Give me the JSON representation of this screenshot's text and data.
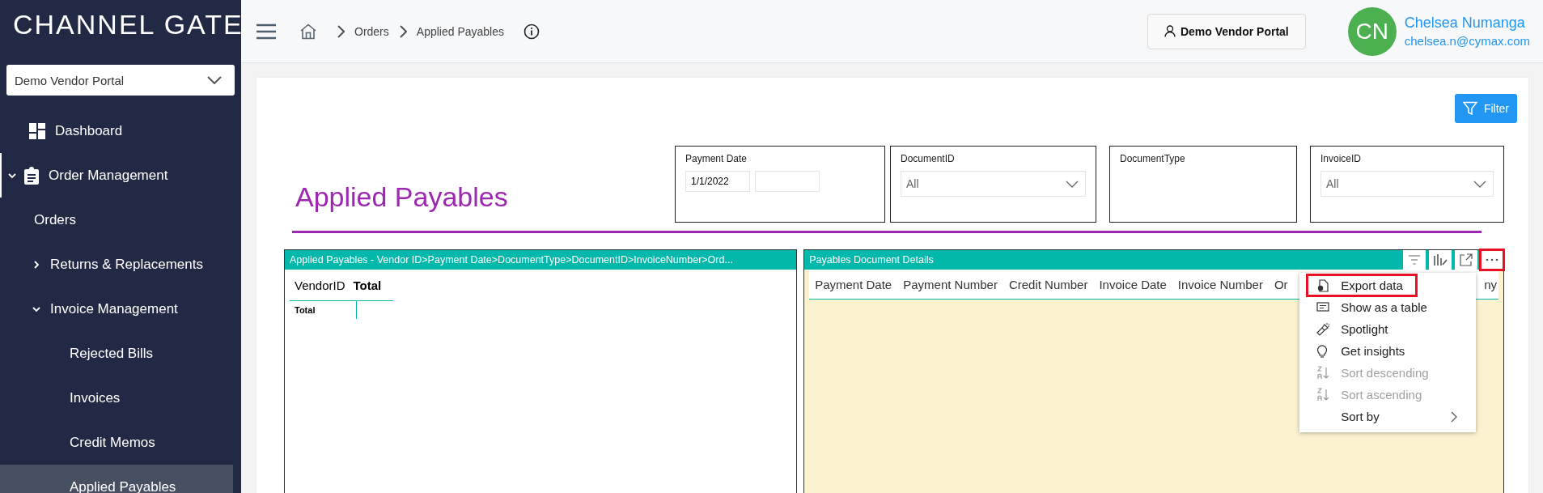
{
  "sidebar": {
    "logo": "CHANNEL GATE",
    "portal_select": {
      "value": "Demo Vendor Portal"
    },
    "items": [
      {
        "label": "Dashboard",
        "kind": "dashboard",
        "highlighted": false,
        "selected": false
      },
      {
        "label": "Order Management",
        "kind": "section",
        "highlighted": true,
        "selected": false,
        "expanded": true,
        "children": [
          {
            "label": "Orders",
            "selected": false
          },
          {
            "label": "Returns & Replacements",
            "selected": false,
            "expanded": false
          },
          {
            "label": "Invoice Management",
            "selected": false,
            "expanded": true,
            "children": [
              {
                "label": "Rejected Bills",
                "selected": false
              },
              {
                "label": "Invoices",
                "selected": false
              },
              {
                "label": "Credit Memos",
                "selected": false
              },
              {
                "label": "Applied Payables",
                "selected": true
              }
            ]
          }
        ]
      }
    ]
  },
  "header": {
    "breadcrumb": [
      {
        "label": "Orders"
      },
      {
        "label": "Applied Payables"
      }
    ],
    "portal_button": "Demo Vendor Portal",
    "user": {
      "initials": "CN",
      "name": "Chelsea Numanga",
      "email": "chelsea.n@cymax.com"
    }
  },
  "report": {
    "filter_button": "Filter",
    "title": "Applied Payables",
    "slicers": [
      {
        "kind": "date_range",
        "label": "Payment Date",
        "start": "1/1/2022"
      },
      {
        "kind": "dropdown",
        "label": "DocumentID",
        "value": "All"
      },
      {
        "kind": "blank",
        "label": "DocumentType"
      },
      {
        "kind": "dropdown",
        "label": "InvoiceID",
        "value": "All"
      }
    ],
    "visuals": [
      {
        "kind": "matrix",
        "title": "Applied Payables - Vendor ID>Payment Date>DocumentType>DocumentID>InvoiceNumber>Ord...",
        "columns": [
          "VendorID",
          "Total"
        ],
        "rows": [
          "Total"
        ]
      },
      {
        "kind": "table",
        "title": "Payables Document Details",
        "columns": [
          "Payment Date",
          "Payment Number",
          "Credit Number",
          "Invoice Date",
          "Invoice Number",
          "Or",
          "ny"
        ],
        "more_options_selected": true,
        "menu": [
          {
            "label": "Export data",
            "kind": "export",
            "disabled": false,
            "selected": true
          },
          {
            "label": "Show as a table",
            "kind": "table",
            "disabled": false,
            "selected": false
          },
          {
            "label": "Spotlight",
            "kind": "spotlight",
            "disabled": false,
            "selected": false
          },
          {
            "label": "Get insights",
            "kind": "insights",
            "disabled": false,
            "selected": false
          },
          {
            "label": "Sort descending",
            "kind": "sortdesc",
            "disabled": true,
            "selected": false
          },
          {
            "label": "Sort ascending",
            "kind": "sortasc",
            "disabled": true,
            "selected": false
          },
          {
            "label": "Sort by",
            "kind": "sortby",
            "disabled": false,
            "selected": false,
            "submenu": true
          }
        ]
      }
    ]
  }
}
